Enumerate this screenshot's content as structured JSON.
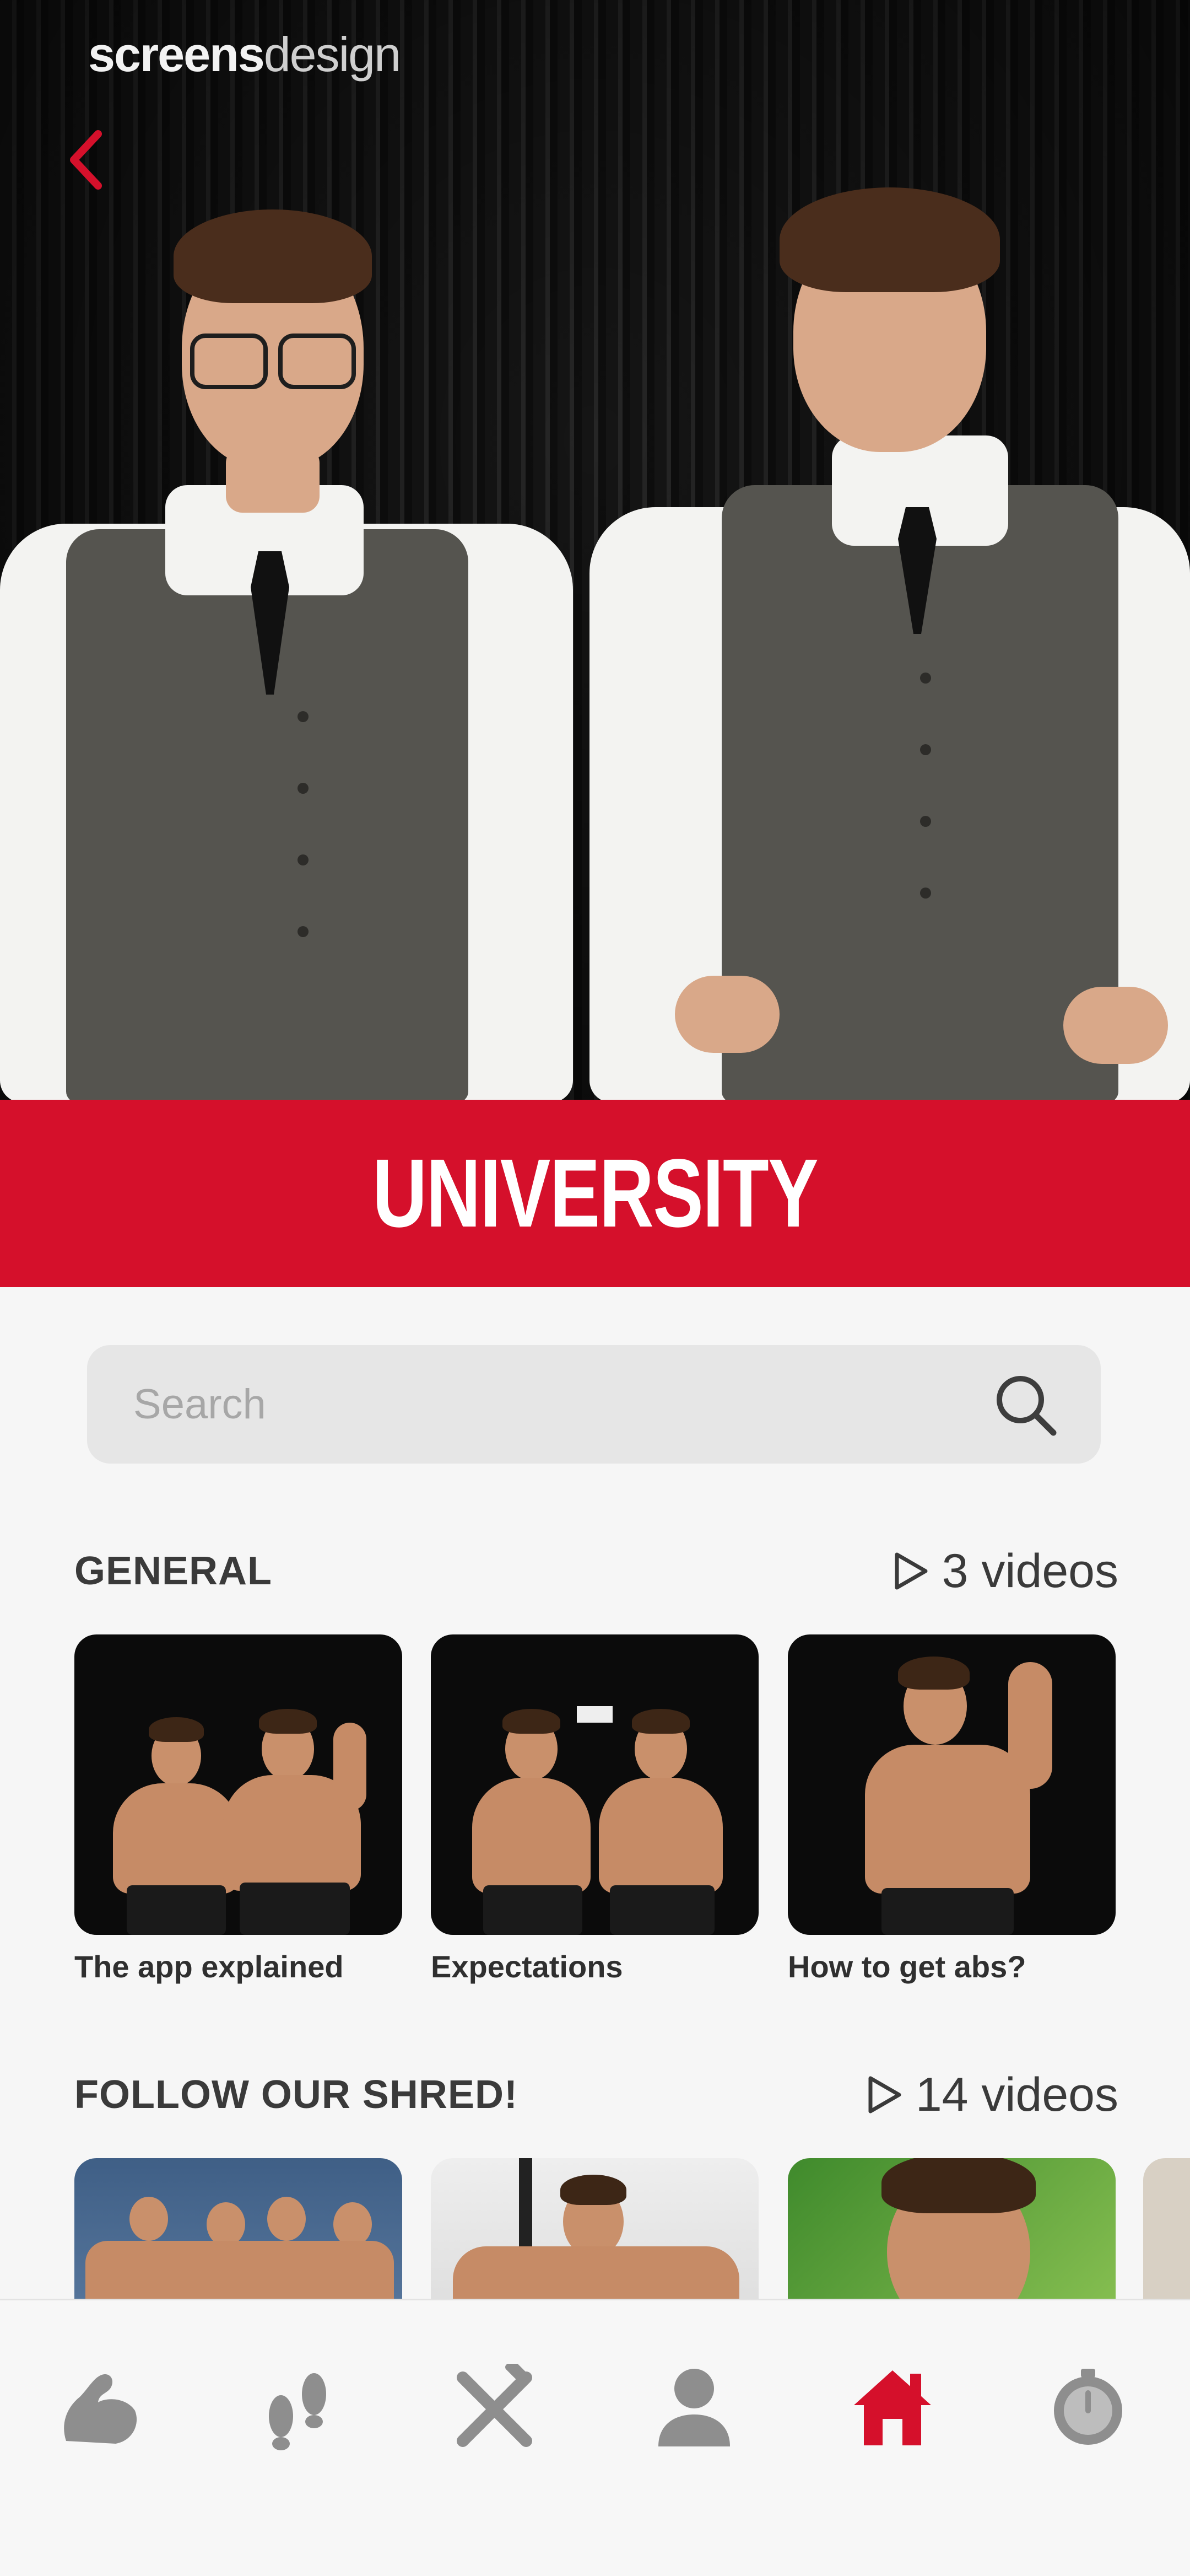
{
  "watermark": {
    "brand": "screens",
    "brand_light": "design"
  },
  "header": {
    "title": "UNIVERSITY"
  },
  "search": {
    "placeholder": "Search"
  },
  "sections": [
    {
      "title": "GENERAL",
      "count": "3 videos",
      "videos": [
        {
          "title": "The app explained"
        },
        {
          "title": "Expectations"
        },
        {
          "title": "How to get abs?"
        }
      ]
    },
    {
      "title": "FOLLOW OUR SHRED!",
      "count": "14 videos",
      "videos": [
        {},
        {},
        {},
        {}
      ]
    }
  ],
  "nav": {
    "items": [
      "flexed-arm-icon",
      "footsteps-icon",
      "fork-knife-icon",
      "person-icon",
      "home-icon",
      "stopwatch-icon"
    ],
    "active": "home-icon"
  },
  "colors": {
    "accent": "#d5102b",
    "nav_inactive": "#8e8e8e"
  }
}
